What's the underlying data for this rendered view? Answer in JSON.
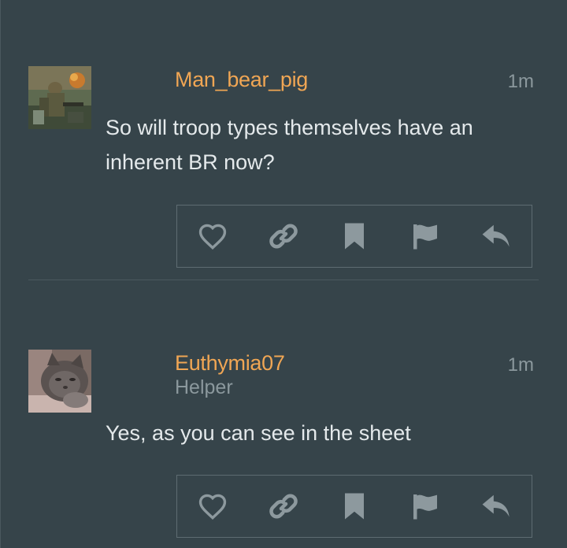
{
  "posts": [
    {
      "username": "Man_bear_pig",
      "user_title": "",
      "time": "1m",
      "body": "So will troop types themselves have an inherent BR now?",
      "avatar": "soldier-avatar"
    },
    {
      "username": "Euthymia07",
      "user_title": "Helper",
      "time": "1m",
      "body": "Yes, as you can see in the sheet",
      "avatar": "cat-avatar"
    }
  ],
  "actions": [
    "like",
    "copy-link",
    "bookmark",
    "flag",
    "reply"
  ],
  "colors": {
    "background": "#36444a",
    "username": "#f0a654",
    "muted": "#8b989d",
    "text": "#e4e9eb",
    "icon": "#8d999e",
    "border": "#5e6c72"
  }
}
